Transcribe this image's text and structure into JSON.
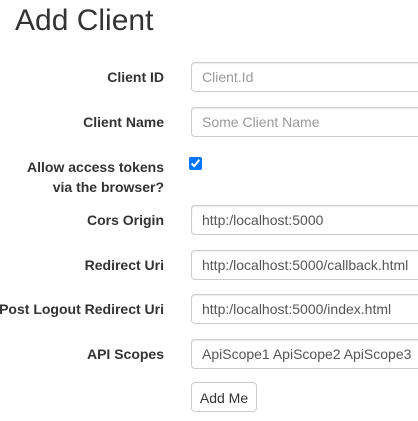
{
  "page": {
    "title": "Add Client"
  },
  "form": {
    "client_id": {
      "label": "Client ID",
      "value": "",
      "placeholder": "Client.Id"
    },
    "client_name": {
      "label": "Client Name",
      "value": "",
      "placeholder": "Some Client Name"
    },
    "allow_tokens": {
      "label": "Allow access tokens via the browser?",
      "checked": true
    },
    "cors_origin": {
      "label": "Cors Origin",
      "value": "http:/localhost:5000",
      "placeholder": ""
    },
    "redirect_uri": {
      "label": "Redirect Uri",
      "value": "http:/localhost:5000/callback.html",
      "placeholder": ""
    },
    "post_logout_redirect_uri": {
      "label": "Post Logout Redirect Uri",
      "value": "http:/localhost:5000/index.html",
      "placeholder": ""
    },
    "api_scopes": {
      "label": "API Scopes",
      "value": "ApiScope1 ApiScope2 ApiScope3",
      "placeholder": ""
    },
    "submit_label": "Add Me"
  }
}
